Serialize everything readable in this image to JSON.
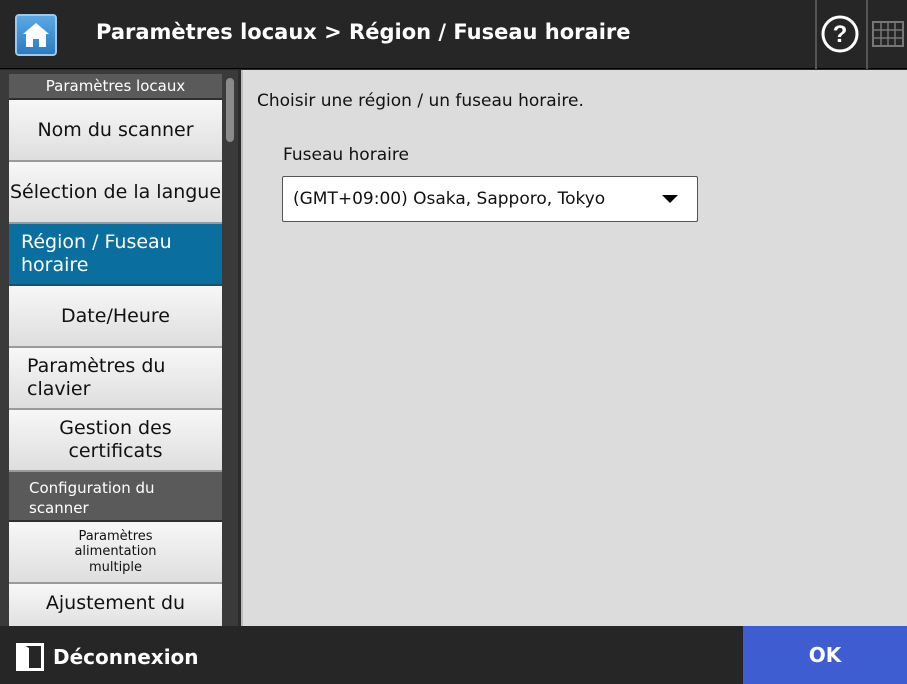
{
  "header": {
    "title": "Paramètres locaux > Région / Fuseau horaire",
    "home_icon": "home-icon",
    "help_icon": "help-icon",
    "keyboard_icon": "keyboard-icon"
  },
  "sidebar": {
    "sections": [
      {
        "title": "Paramètres locaux",
        "items": [
          {
            "label": "Nom du scanner",
            "selected": false
          },
          {
            "label": "Sélection de la langue",
            "selected": false
          },
          {
            "label": "Région / Fuseau horaire",
            "selected": true
          },
          {
            "label": "Date/Heure",
            "selected": false
          },
          {
            "label": "Paramètres du clavier",
            "selected": false
          },
          {
            "label": "Gestion des certificats",
            "selected": false
          }
        ]
      },
      {
        "title": "Configuration du scanner",
        "items": [
          {
            "label": "Paramètres alimentation multiple",
            "selected": false
          },
          {
            "label": "Ajustement du",
            "selected": false
          }
        ]
      }
    ]
  },
  "main": {
    "instruction": "Choisir une région / un fuseau horaire.",
    "field_label": "Fuseau horaire",
    "timezone_value": "(GMT+09:00) Osaka, Sapporo, Tokyo"
  },
  "footer": {
    "logout_label": "Déconnexion",
    "ok_label": "OK"
  },
  "colors": {
    "header_bg": "#262626",
    "selected_item_bg": "#0a6f9e",
    "ok_button_bg": "#3d5dd1",
    "content_bg": "#dcdcdc"
  }
}
